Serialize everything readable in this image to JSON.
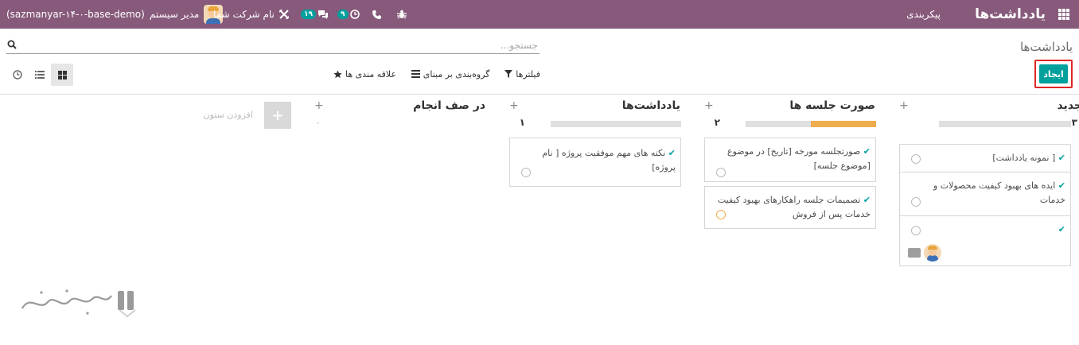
{
  "navbar": {
    "brand": "یادداشت‌ها",
    "config": "پیکربندی",
    "company": "نام شرکت شما",
    "user": "مدیر سیستم",
    "database": "(sazmanyar-۱۴-۰-base-demo)",
    "messages_badge": "۱۹",
    "activities_badge": "۹"
  },
  "control_panel": {
    "breadcrumb": "یادداشت‌ها",
    "search_placeholder": "جستجو...",
    "create_label": "ایجاد",
    "filters_label": "فیلترها",
    "groupby_label": "گروه‌بندی بر مبنای",
    "favorites_label": "علاقه مندی ها",
    "views": [
      "kanban",
      "list",
      "activity"
    ],
    "active_view": "kanban"
  },
  "kanban": {
    "columns": [
      {
        "title": "جدید",
        "count": "۳",
        "progress": [],
        "cards": [
          {
            "text": "[ نمونه یادداشت]",
            "activity": "none"
          },
          {
            "text": "ایده های بهبود کیفیت محصولات و خدمات",
            "activity": "none"
          },
          {
            "text": "",
            "activity": "none",
            "has_avatar": true,
            "has_attachment": true
          }
        ]
      },
      {
        "title": "صورت جلسه ها",
        "count": "۲",
        "progress": [
          {
            "color": "#f0ad4e",
            "fraction": 0.5
          }
        ],
        "cards": [
          {
            "text": "صورتجلسه مورخه [تاریخ] در موضوع [موضوع جلسه]",
            "activity": "none"
          },
          {
            "text": "تصمیمات جلسه راهکارهای بهبود کیفیت خدمات پس از فروش",
            "activity": "warning"
          }
        ]
      },
      {
        "title": "یادداشت‌ها",
        "count": "۱",
        "progress": [],
        "cards": [
          {
            "text": "نکته های مهم موفقیت پروژه [ نام پروژه]",
            "activity": "none"
          }
        ]
      },
      {
        "title": "در صف انجام",
        "count": "۰",
        "progress": [],
        "cards": []
      }
    ],
    "add_column_label": "افزودن ستون"
  },
  "colors": {
    "navbar": "#875a7b",
    "primary": "#00a09d",
    "warning": "#f0ad4e",
    "highlight_border": "#e02626"
  }
}
